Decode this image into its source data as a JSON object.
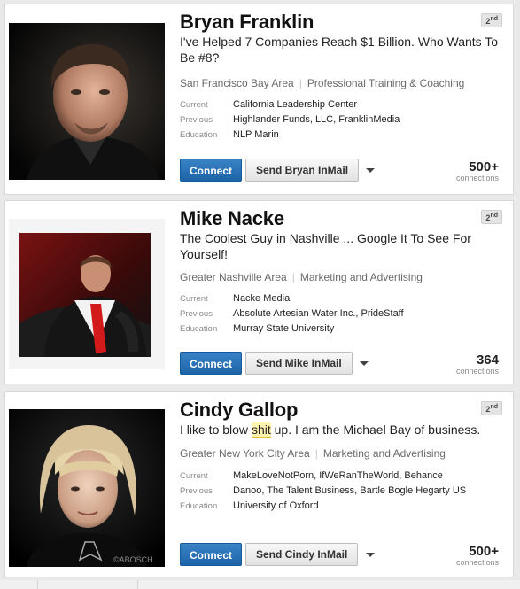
{
  "results": [
    {
      "name": "Bryan Franklin",
      "degree_num": "2",
      "degree_suffix": "nd",
      "headline_pre": "I've Helped 7 Companies Reach $1 Billion. Who Wants To Be #8?",
      "headline_mark": "",
      "headline_post": "",
      "location": "San Francisco Bay Area",
      "industry": "Professional Training & Coaching",
      "current_label": "Current",
      "current": "California Leadership Center",
      "previous_label": "Previous",
      "previous": "Highlander Funds, LLC, FranklinMedia",
      "education_label": "Education",
      "education": "NLP Marin",
      "connect_label": "Connect",
      "inmail_label": "Send Bryan InMail",
      "connections": "500+",
      "connections_label": "connections"
    },
    {
      "name": "Mike Nacke",
      "degree_num": "2",
      "degree_suffix": "nd",
      "headline_pre": "The Coolest Guy in Nashville ... Google It To See For Yourself!",
      "headline_mark": "",
      "headline_post": "",
      "location": "Greater Nashville Area",
      "industry": "Marketing and Advertising",
      "current_label": "Current",
      "current": "Nacke Media",
      "previous_label": "Previous",
      "previous": "Absolute Artesian Water Inc., PrideStaff",
      "education_label": "Education",
      "education": "Murray State University",
      "connect_label": "Connect",
      "inmail_label": "Send Mike InMail",
      "connections": "364",
      "connections_label": "connections"
    },
    {
      "name": "Cindy Gallop",
      "degree_num": "2",
      "degree_suffix": "nd",
      "headline_pre": "I like to blow ",
      "headline_mark": "shit",
      "headline_post": " up. I am the Michael Bay of business.",
      "location": "Greater New York City Area",
      "industry": "Marketing and Advertising",
      "current_label": "Current",
      "current": "MakeLoveNotPorn, IfWeRanTheWorld, Behance",
      "previous_label": "Previous",
      "previous": "Danoo, The Talent Business, Bartle Bogle Hegarty US",
      "education_label": "Education",
      "education": "University of Oxford",
      "connect_label": "Connect",
      "inmail_label": "Send Cindy InMail",
      "connections": "500+",
      "connections_label": "connections",
      "photo_watermark": "©ABOSCH"
    }
  ],
  "colors": {
    "connect_button": "#1d64a7",
    "highlight": "#fff3b0",
    "page_background": "#e9e9e9"
  }
}
